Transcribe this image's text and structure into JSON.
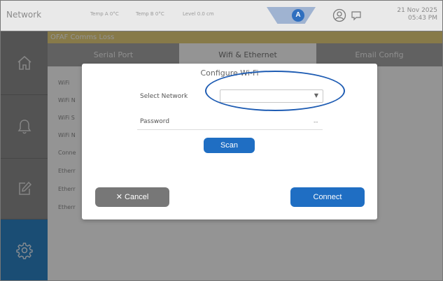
{
  "header": {
    "title": "Network",
    "temp_a": "Temp A  0°C",
    "temp_b": "Temp B  0°C",
    "level": "Level  0.0 cm",
    "badge": "A",
    "date": "21 Nov 2025",
    "time": "05:43 PM"
  },
  "alert": "OFAF Comms Loss",
  "tabs": [
    "Serial Port",
    "Wifi & Ethernet",
    "Email Config"
  ],
  "rows": [
    "WiFi",
    "WiFi N",
    "WiFi S",
    "WiFi N",
    "Conne",
    "Etherr",
    "Etherr",
    "Etherr"
  ],
  "dialog": {
    "title": "Configure Wi-Fi",
    "select_label": "Select Network",
    "select_value": "",
    "password_label": "Password",
    "password_value": "--",
    "scan": "Scan",
    "cancel": "Cancel",
    "connect": "Connect"
  },
  "colors": {
    "accent": "#1f6ec3",
    "sidebar_active": "#2e86c9",
    "alert": "#e9d27e"
  },
  "icons": [
    "home-icon",
    "bell-icon",
    "edit-icon",
    "settings-gear-icon",
    "user-icon",
    "chat-icon"
  ]
}
